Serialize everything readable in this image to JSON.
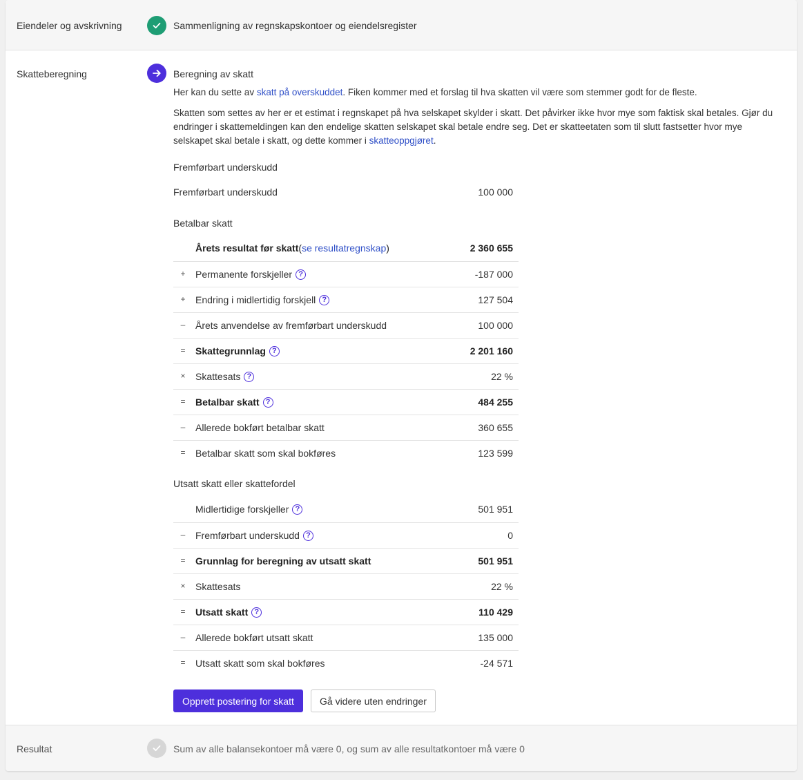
{
  "steps": {
    "assets": {
      "label": "Eiendeler og avskrivning",
      "title": "Sammenligning av regnskapskontoer og eiendelsregister"
    },
    "tax": {
      "label": "Skatteberegning",
      "title": "Beregning av skatt"
    },
    "result": {
      "label": "Resultat",
      "title": "Sum av alle balansekontoer må være 0, og sum av alle resultatkontoer må være 0"
    }
  },
  "intro": {
    "p1_pre": "Her kan du sette av ",
    "p1_link": "skatt på overskuddet",
    "p1_post": ". Fiken kommer med et forslag til hva skatten vil være som stemmer godt for de fleste.",
    "p2_pre": "Skatten som settes av her er et estimat i regnskapet på hva selskapet skylder i skatt. Det påvirker ikke hvor mye som faktisk skal betales. Gjør du endringer i skattemeldingen kan den endelige skatten selskapet skal betale endre seg. Det er skatteetaten som til slutt fastsetter hvor mye selskapet skal betale i skatt, og dette kommer i ",
    "p2_link": "skatteoppgjøret",
    "p2_post": "."
  },
  "carryforward": {
    "heading": "Fremførbart underskudd",
    "label": "Fremførbart underskudd",
    "value": "100 000"
  },
  "payable": {
    "heading": "Betalbar skatt",
    "first": {
      "label": "Årets resultat før skatt",
      "paren_open": " (",
      "link": "se resultatregnskap",
      "paren_close": ")",
      "value": "2 360 655"
    },
    "rows": [
      {
        "op": "+",
        "label": "Permanente forskjeller",
        "value": "-187 000"
      },
      {
        "op": "+",
        "label": "Endring i midlertidig forskjell",
        "value": "127 504"
      },
      {
        "op": "–",
        "label": "Årets anvendelse av fremførbart underskudd",
        "value": "100 000"
      },
      {
        "op": "=",
        "label": "Skattegrunnlag",
        "value": "2 201 160"
      },
      {
        "op": "×",
        "label": "Skattesats",
        "value": "22 %"
      },
      {
        "op": "=",
        "label": "Betalbar skatt",
        "value": "484 255"
      },
      {
        "op": "–",
        "label": "Allerede bokført betalbar skatt",
        "value": "360 655"
      },
      {
        "op": "=",
        "label": "Betalbar skatt som skal bokføres",
        "value": "123 599"
      }
    ]
  },
  "deferred": {
    "heading": "Utsatt skatt eller skattefordel",
    "rows": [
      {
        "op": "",
        "label": "Midlertidige forskjeller",
        "value": "501 951"
      },
      {
        "op": "–",
        "label": "Fremførbart underskudd",
        "value": "0"
      },
      {
        "op": "=",
        "label": "Grunnlag for beregning av utsatt skatt",
        "value": "501 951"
      },
      {
        "op": "×",
        "label": "Skattesats",
        "value": "22 %"
      },
      {
        "op": "=",
        "label": "Utsatt skatt",
        "value": "110 429"
      },
      {
        "op": "–",
        "label": "Allerede bokført utsatt skatt",
        "value": "135 000"
      },
      {
        "op": "=",
        "label": "Utsatt skatt som skal bokføres",
        "value": "-24 571"
      }
    ]
  },
  "help_glyph": "?",
  "buttons": {
    "create": "Opprett postering for skatt",
    "skip": "Gå videre uten endringer"
  },
  "colors": {
    "success": "#1e9d74",
    "accent": "#4d2fdc",
    "link": "#2f4fc7",
    "disabled": "#d6d6d6"
  },
  "icons": {
    "assets_status": "check-icon",
    "tax_status": "arrow-right-icon",
    "result_status": "check-icon",
    "help": "help-circle-icon"
  }
}
